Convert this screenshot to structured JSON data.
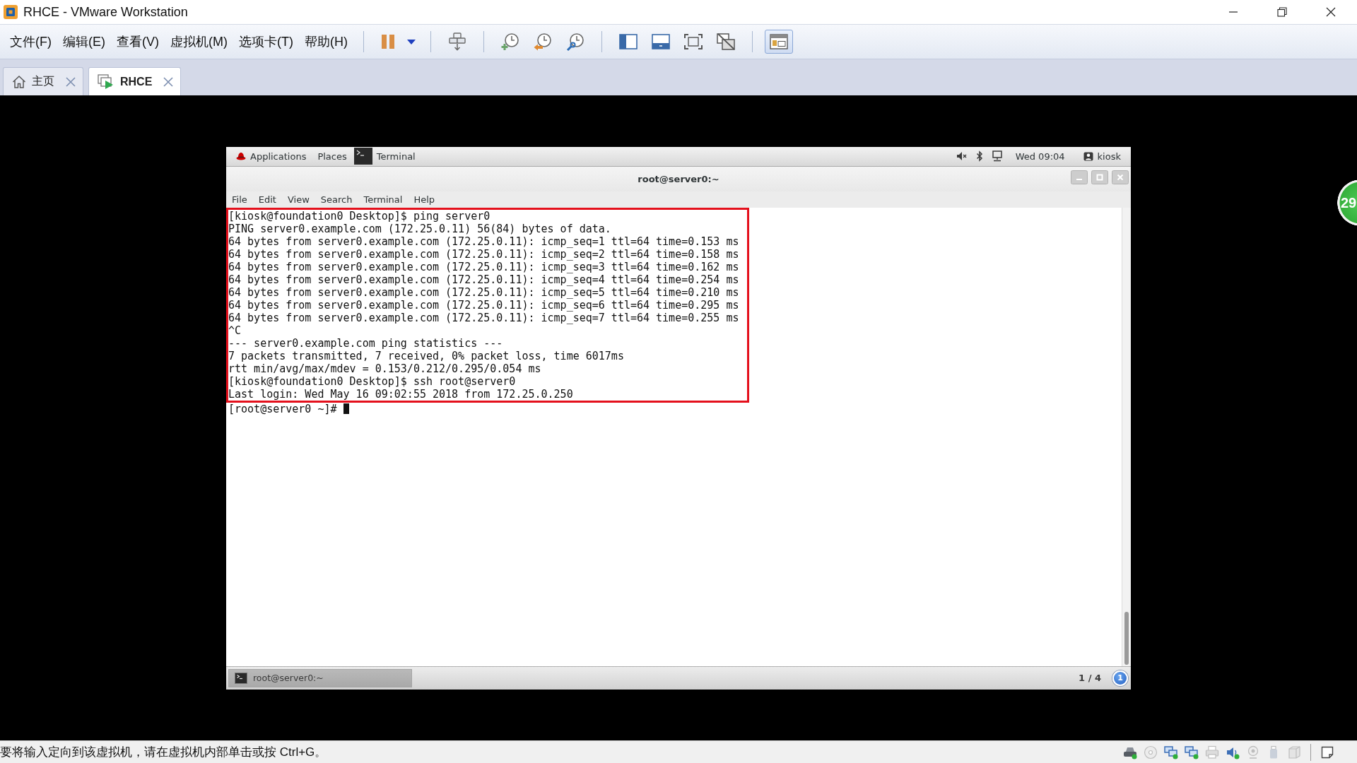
{
  "window": {
    "title": "RHCE - VMware Workstation"
  },
  "menu": [
    "文件(F)",
    "编辑(E)",
    "查看(V)",
    "虚拟机(M)",
    "选项卡(T)",
    "帮助(H)"
  ],
  "toolbar": [
    {
      "buttons": [
        {
          "kind": "pause",
          "on": false
        },
        {
          "kind": "dropdown",
          "on": false
        }
      ]
    },
    {
      "buttons": [
        {
          "kind": "send-keys",
          "on": false
        }
      ]
    },
    {
      "buttons": [
        {
          "kind": "snapshot-take",
          "on": false
        },
        {
          "kind": "snapshot-revert",
          "on": false
        },
        {
          "kind": "snapshot-manage",
          "on": false
        }
      ]
    },
    {
      "buttons": [
        {
          "kind": "sidebar",
          "on": false
        },
        {
          "kind": "thumbnail-bar",
          "on": false
        },
        {
          "kind": "fullscreen",
          "on": false
        },
        {
          "kind": "unity",
          "on": false
        }
      ]
    },
    {
      "buttons": [
        {
          "kind": "console-view",
          "on": true
        }
      ]
    }
  ],
  "tabs": [
    {
      "kind": "home",
      "label": "主页",
      "selected": false
    },
    {
      "kind": "vm",
      "label": "RHCE",
      "selected": true
    }
  ],
  "guest": {
    "top_bar": {
      "applications": "Applications",
      "places": "Places",
      "active_window": "Terminal",
      "clock": "Wed 09:04",
      "user": "kiosk"
    },
    "terminal": {
      "title": "root@server0:~",
      "menu": [
        "File",
        "Edit",
        "View",
        "Search",
        "Terminal",
        "Help"
      ],
      "blocks": [
        {
          "highlighted": true,
          "lines": [
            "[kiosk@foundation0 Desktop]$ ping server0",
            "PING server0.example.com (172.25.0.11) 56(84) bytes of data.",
            "64 bytes from server0.example.com (172.25.0.11): icmp_seq=1 ttl=64 time=0.153 ms",
            "64 bytes from server0.example.com (172.25.0.11): icmp_seq=2 ttl=64 time=0.158 ms",
            "64 bytes from server0.example.com (172.25.0.11): icmp_seq=3 ttl=64 time=0.162 ms",
            "64 bytes from server0.example.com (172.25.0.11): icmp_seq=4 ttl=64 time=0.254 ms",
            "64 bytes from server0.example.com (172.25.0.11): icmp_seq=5 ttl=64 time=0.210 ms",
            "64 bytes from server0.example.com (172.25.0.11): icmp_seq=6 ttl=64 time=0.295 ms",
            "64 bytes from server0.example.com (172.25.0.11): icmp_seq=7 ttl=64 time=0.255 ms",
            "^C",
            "--- server0.example.com ping statistics ---",
            "7 packets transmitted, 7 received, 0% packet loss, time 6017ms",
            "rtt min/avg/max/mdev = 0.153/0.212/0.295/0.054 ms",
            "[kiosk@foundation0 Desktop]$ ssh root@server0",
            "Last login: Wed May 16 09:02:55 2018 from 172.25.0.250"
          ]
        },
        {
          "highlighted": false,
          "lines": [
            "[root@server0 ~]#"
          ]
        }
      ],
      "cursor": true
    },
    "bottom_panel": {
      "window_button": {
        "label": "root@server0:~",
        "selected": true
      },
      "workspace": "1 / 4",
      "notifications": "1"
    }
  },
  "floating_badge": {
    "label": "29"
  },
  "status_bar": {
    "message": "要将输入定向到该虚拟机，请在虚拟机内部单击或按 Ctrl+G。",
    "devices": [
      {
        "kind": "hard-disk",
        "connected": true
      },
      {
        "kind": "disc",
        "connected": false
      },
      {
        "kind": "network",
        "connected": true
      },
      {
        "kind": "network",
        "connected": true
      },
      {
        "kind": "printer",
        "connected": false
      },
      {
        "kind": "sound",
        "connected": true
      },
      {
        "kind": "camera",
        "connected": false
      },
      {
        "kind": "usb",
        "connected": false
      },
      {
        "kind": "display",
        "connected": false
      }
    ]
  }
}
